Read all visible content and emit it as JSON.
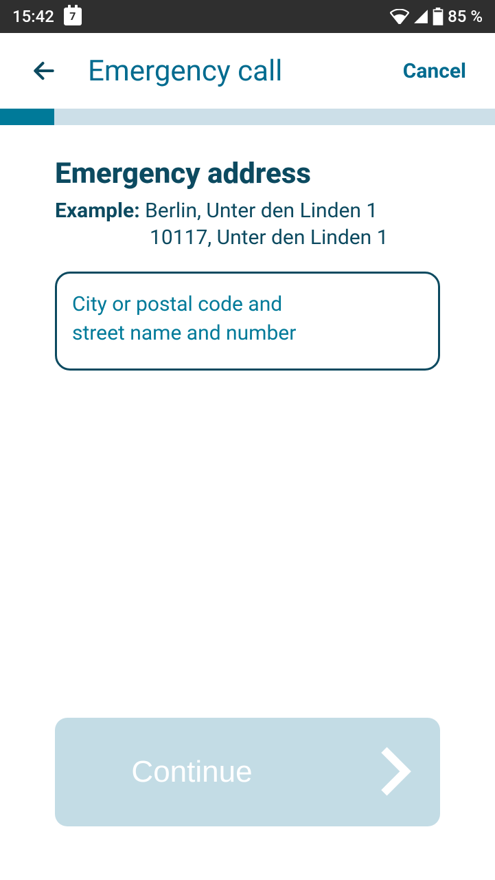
{
  "status_bar": {
    "time": "15:42",
    "calendar_day": "7",
    "battery_text": "85 %"
  },
  "header": {
    "title": "Emergency call",
    "cancel": "Cancel"
  },
  "progress": {
    "percent": 11
  },
  "main": {
    "heading": "Emergency address",
    "example_label": "Example:",
    "example_line1": "Berlin, Unter den Linden 1",
    "example_line2": "10117, Unter den Linden 1",
    "input_placeholder": "City or postal code and\nstreet name and number",
    "input_value": ""
  },
  "footer": {
    "continue": "Continue"
  },
  "colors": {
    "accent": "#006b8f",
    "dark": "#0c4a60",
    "progress_fill": "#007a99",
    "progress_track": "#ccdfe8",
    "button_bg": "#c3dce5"
  }
}
